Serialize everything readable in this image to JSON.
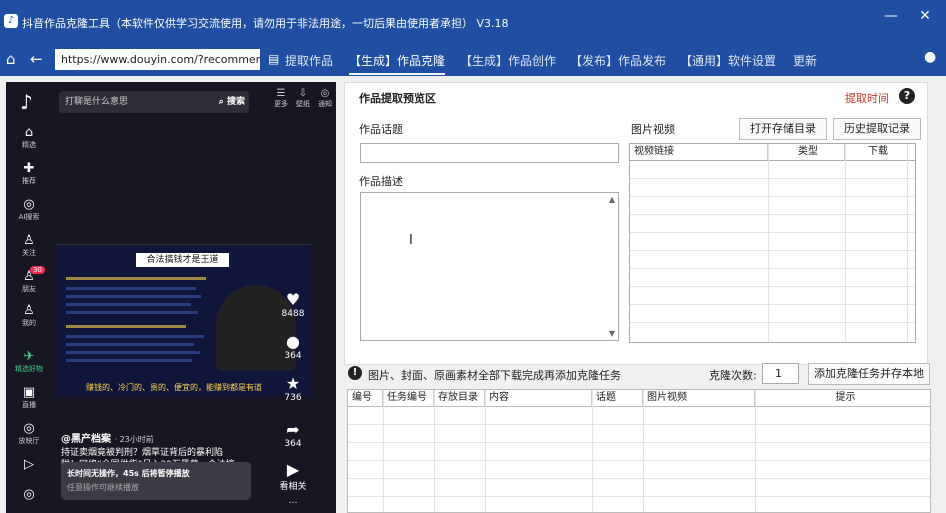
{
  "window": {
    "title": "抖音作品克隆工具（本软件仅供学习交流使用，请勿用于非法用途，一切后果由使用者承担） V3.18",
    "minimize": "—",
    "close": "✕"
  },
  "nav": {
    "url": "https://www.douyin.com/?recommenc",
    "menus": [
      "提取作品",
      "【生成】作品克隆",
      "【生成】作品创作",
      "【发布】作品发布",
      "【通用】软件设置",
      "更新"
    ],
    "active_index": 1
  },
  "douyin": {
    "search_placeholder": "打聊是什么意思",
    "search_btn": "搜索",
    "top_icons": [
      {
        "g": "☰",
        "label": "更多"
      },
      {
        "g": "⇩",
        "label": "壁纸"
      },
      {
        "g": "◎",
        "label": "通知"
      }
    ],
    "side_items": [
      {
        "g": "⌂",
        "label": "精选"
      },
      {
        "g": "✚",
        "label": "推荐"
      },
      {
        "g": "◎",
        "label": "AI搜索"
      },
      {
        "g": "♙",
        "label": "关注"
      },
      {
        "g": "♙",
        "label": "朋友"
      },
      {
        "g": "♙",
        "label": "我的"
      },
      {
        "g": "✈",
        "label": "精选好物"
      },
      {
        "g": "▣",
        "label": "直播"
      },
      {
        "g": "◎",
        "label": "放映厅"
      },
      {
        "g": "▷",
        "label": ""
      },
      {
        "g": "◎",
        "label": ""
      }
    ],
    "friend_badge": "30",
    "poster_title": "合法搞钱才是王道",
    "poster_caption": "赚钱的、冷门的、贵的、便宜的，能赚到都是有道",
    "likes": "8488",
    "comments": "364",
    "favorites": "736",
    "shares": "364",
    "related": "看相关",
    "more": "…",
    "author": "@黑产档案",
    "time_ago": "· 23小时前",
    "desc1": "持证卖烟竟被判刑？烟草证背后的暴利陷",
    "desc2": "阱！网络“全国供货”月入30万黑幕，合法搞",
    "toast_title": "长时间无操作，45s 后将暂停播放",
    "toast_sub": "任意操作可继续播放"
  },
  "preview": {
    "section_title": "作品提取预览区",
    "extract_time": "提取时间",
    "help": "?",
    "topic_label": "作品话题",
    "topic_value": "",
    "desc_label": "作品描述",
    "desc_value": "",
    "media_label": "图片视频",
    "open_dir_btn": "打开存储目录",
    "history_btn": "历史提取记录",
    "media_cols": [
      "视频链接",
      "类型",
      "下载"
    ]
  },
  "task": {
    "notice": "图片、封面、原画素材全部下载完成再添加克隆任务",
    "clone_count_label": "克隆次数:",
    "clone_count": "1",
    "add_btn": "添加克隆任务并存本地",
    "cols": [
      "编号",
      "任务编号",
      "存放目录",
      "内容",
      "话题",
      "图片视频",
      "提示"
    ]
  }
}
